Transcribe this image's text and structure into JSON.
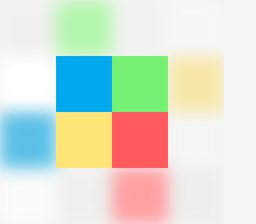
{
  "logo_tiles": [
    {
      "name": "blue-tile",
      "color": "#03a9ef"
    },
    {
      "name": "green-tile",
      "color": "#76f174"
    },
    {
      "name": "yellow-tile",
      "color": "#ffe477"
    },
    {
      "name": "red-tile",
      "color": "#ff5a5f"
    }
  ],
  "background_cells": [
    {
      "name": "blurred-cell-top-left",
      "color": "#f0f0f0"
    },
    {
      "name": "blurred-cell-top-center-left",
      "color": "#b4f6ae"
    },
    {
      "name": "blurred-cell-top-center-right",
      "color": "#f2f2f2"
    },
    {
      "name": "blurred-cell-top-right",
      "color": "#f7f7f7"
    },
    {
      "name": "blurred-cell-middle-left",
      "color": "#ffffff"
    },
    {
      "name": "blurred-cell-middle-right",
      "color": "#f7e7a8"
    },
    {
      "name": "blurred-cell-lower-left",
      "color": "#5bc0e6"
    },
    {
      "name": "blurred-cell-lower-right",
      "color": "#f5f5f5"
    },
    {
      "name": "blurred-cell-bottom-left",
      "color": "#fbfbfb"
    },
    {
      "name": "blurred-cell-bottom-center-left",
      "color": "#efefef"
    },
    {
      "name": "blurred-cell-bottom-center-right",
      "color": "#ff9fa2"
    },
    {
      "name": "blurred-cell-bottom-right",
      "color": "#eeeeee"
    }
  ]
}
